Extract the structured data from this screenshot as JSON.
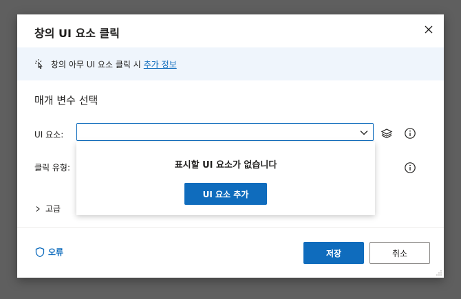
{
  "dialog": {
    "title": "창의 UI 요소 클릭",
    "info_text": "창의 아무 UI 요소 클릭 시",
    "info_link": "추가 정보",
    "section_title": "매개 변수 선택",
    "ui_element_label": "UI 요소:",
    "click_type_label": "클릭 유형:",
    "ui_element_value": "",
    "dropdown": {
      "empty_message": "표시할 UI 요소가 없습니다",
      "add_button": "UI 요소 추가"
    },
    "advanced_label": "고급",
    "footer": {
      "error_label": "오류",
      "save_label": "저장",
      "cancel_label": "취소"
    }
  },
  "icons": {
    "close": "close-icon",
    "info_bar": "touch-cursor-icon",
    "layers": "layers-icon",
    "info": "info-icon",
    "chevron": "chevron-down-icon",
    "shield": "shield-icon"
  },
  "colors": {
    "accent": "#0f6cbd",
    "info_bar_bg": "#eff5fc",
    "backdrop": "#5f5f5f"
  }
}
